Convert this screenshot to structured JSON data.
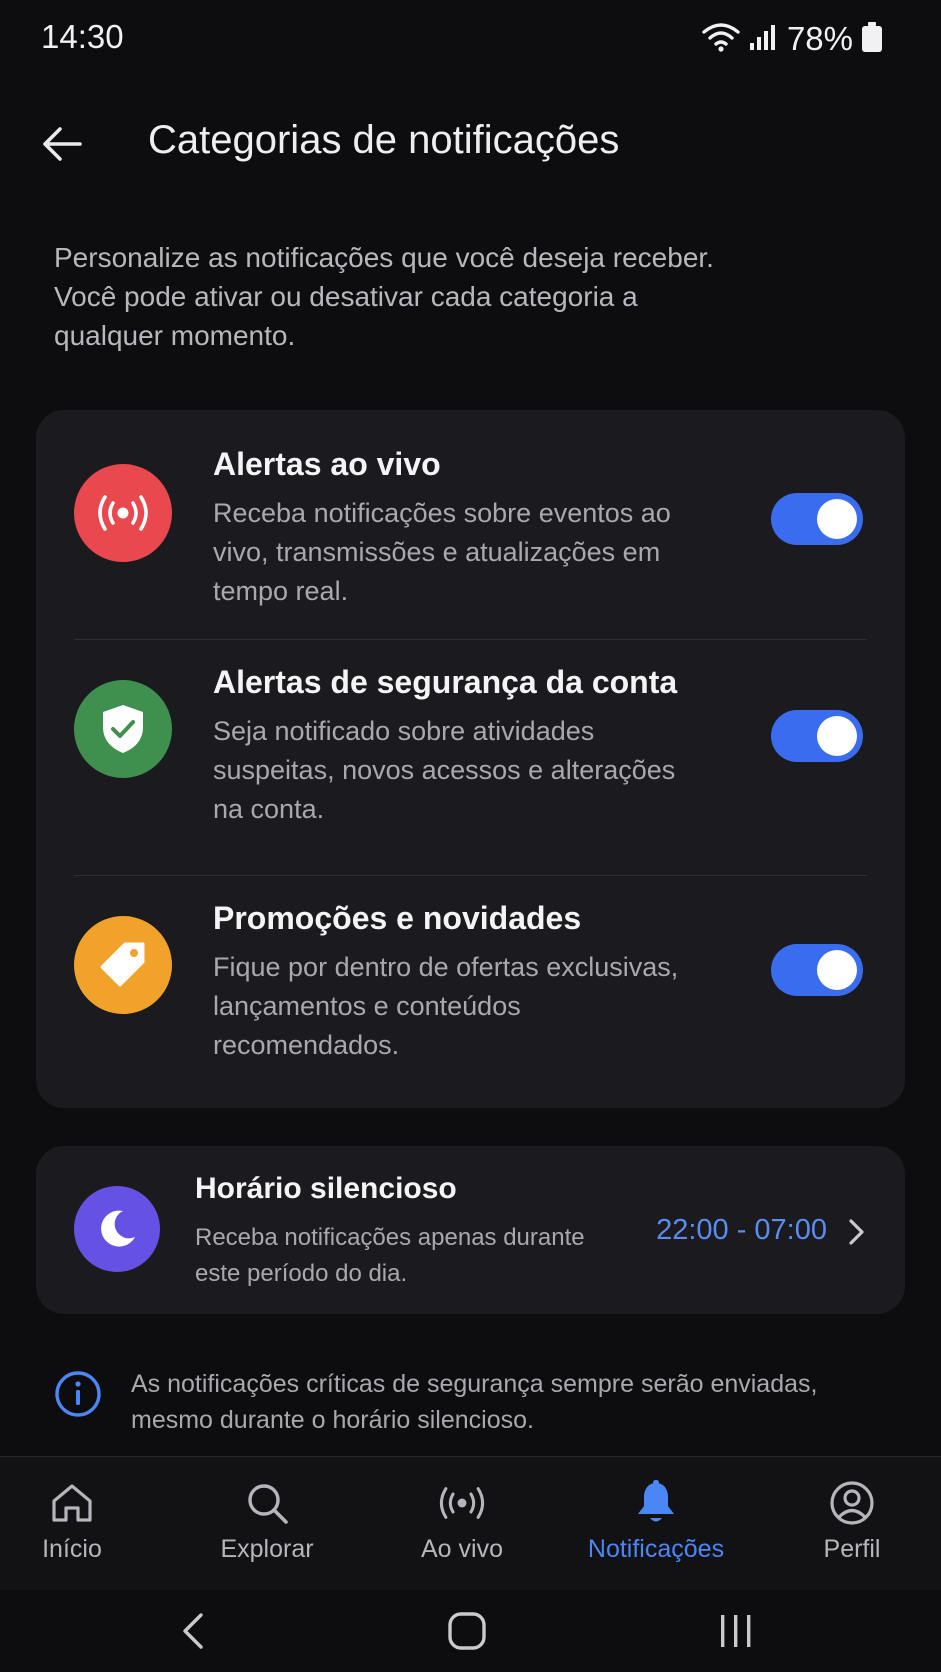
{
  "status_bar": {
    "time": "14:30",
    "battery": "78%"
  },
  "header": {
    "title": "Categorias de notificações"
  },
  "intro": "Personalize as notificações que você deseja receber. Você pode ativar ou desativar cada categoria a qualquer momento.",
  "categories": [
    {
      "title": "Alertas ao vivo",
      "description": "Receba notificações sobre eventos ao vivo, transmissões e atualizações em tempo real.",
      "enabled": true,
      "icon": "broadcast-icon",
      "color": "#e8484e"
    },
    {
      "title": "Alertas de segurança da conta",
      "description": "Seja notificado sobre atividades suspeitas, novos acessos e alterações na conta.",
      "enabled": true,
      "icon": "shield-check-icon",
      "color": "#3f8f4f"
    },
    {
      "title": "Promoções e novidades",
      "description": "Fique por dentro de ofertas exclusivas, lançamentos e conteúdos recomendados.",
      "enabled": true,
      "icon": "tag-icon",
      "color": "#f0a22a"
    }
  ],
  "quiet_hours": {
    "title": "Horário silencioso",
    "description": "Receba notificações apenas durante este período do dia.",
    "time_range": "22:00 - 07:00",
    "icon": "moon-icon",
    "color": "#6551e3"
  },
  "info_note": "As notificações críticas de segurança sempre serão enviadas, mesmo durante o horário silencioso.",
  "bottom_nav": [
    {
      "label": "Início",
      "icon": "home-icon"
    },
    {
      "label": "Explorar",
      "icon": "search-icon"
    },
    {
      "label": "Ao vivo",
      "icon": "broadcast-icon"
    },
    {
      "label": "Notificações",
      "icon": "bell-icon",
      "active": true
    },
    {
      "label": "Perfil",
      "icon": "profile-icon"
    }
  ],
  "colors": {
    "accent": "#3a6cf0",
    "link": "#5a8cf2",
    "active_nav": "#4a86f5",
    "card_bg": "#1b1b1f",
    "background": "#0d0d0f"
  }
}
